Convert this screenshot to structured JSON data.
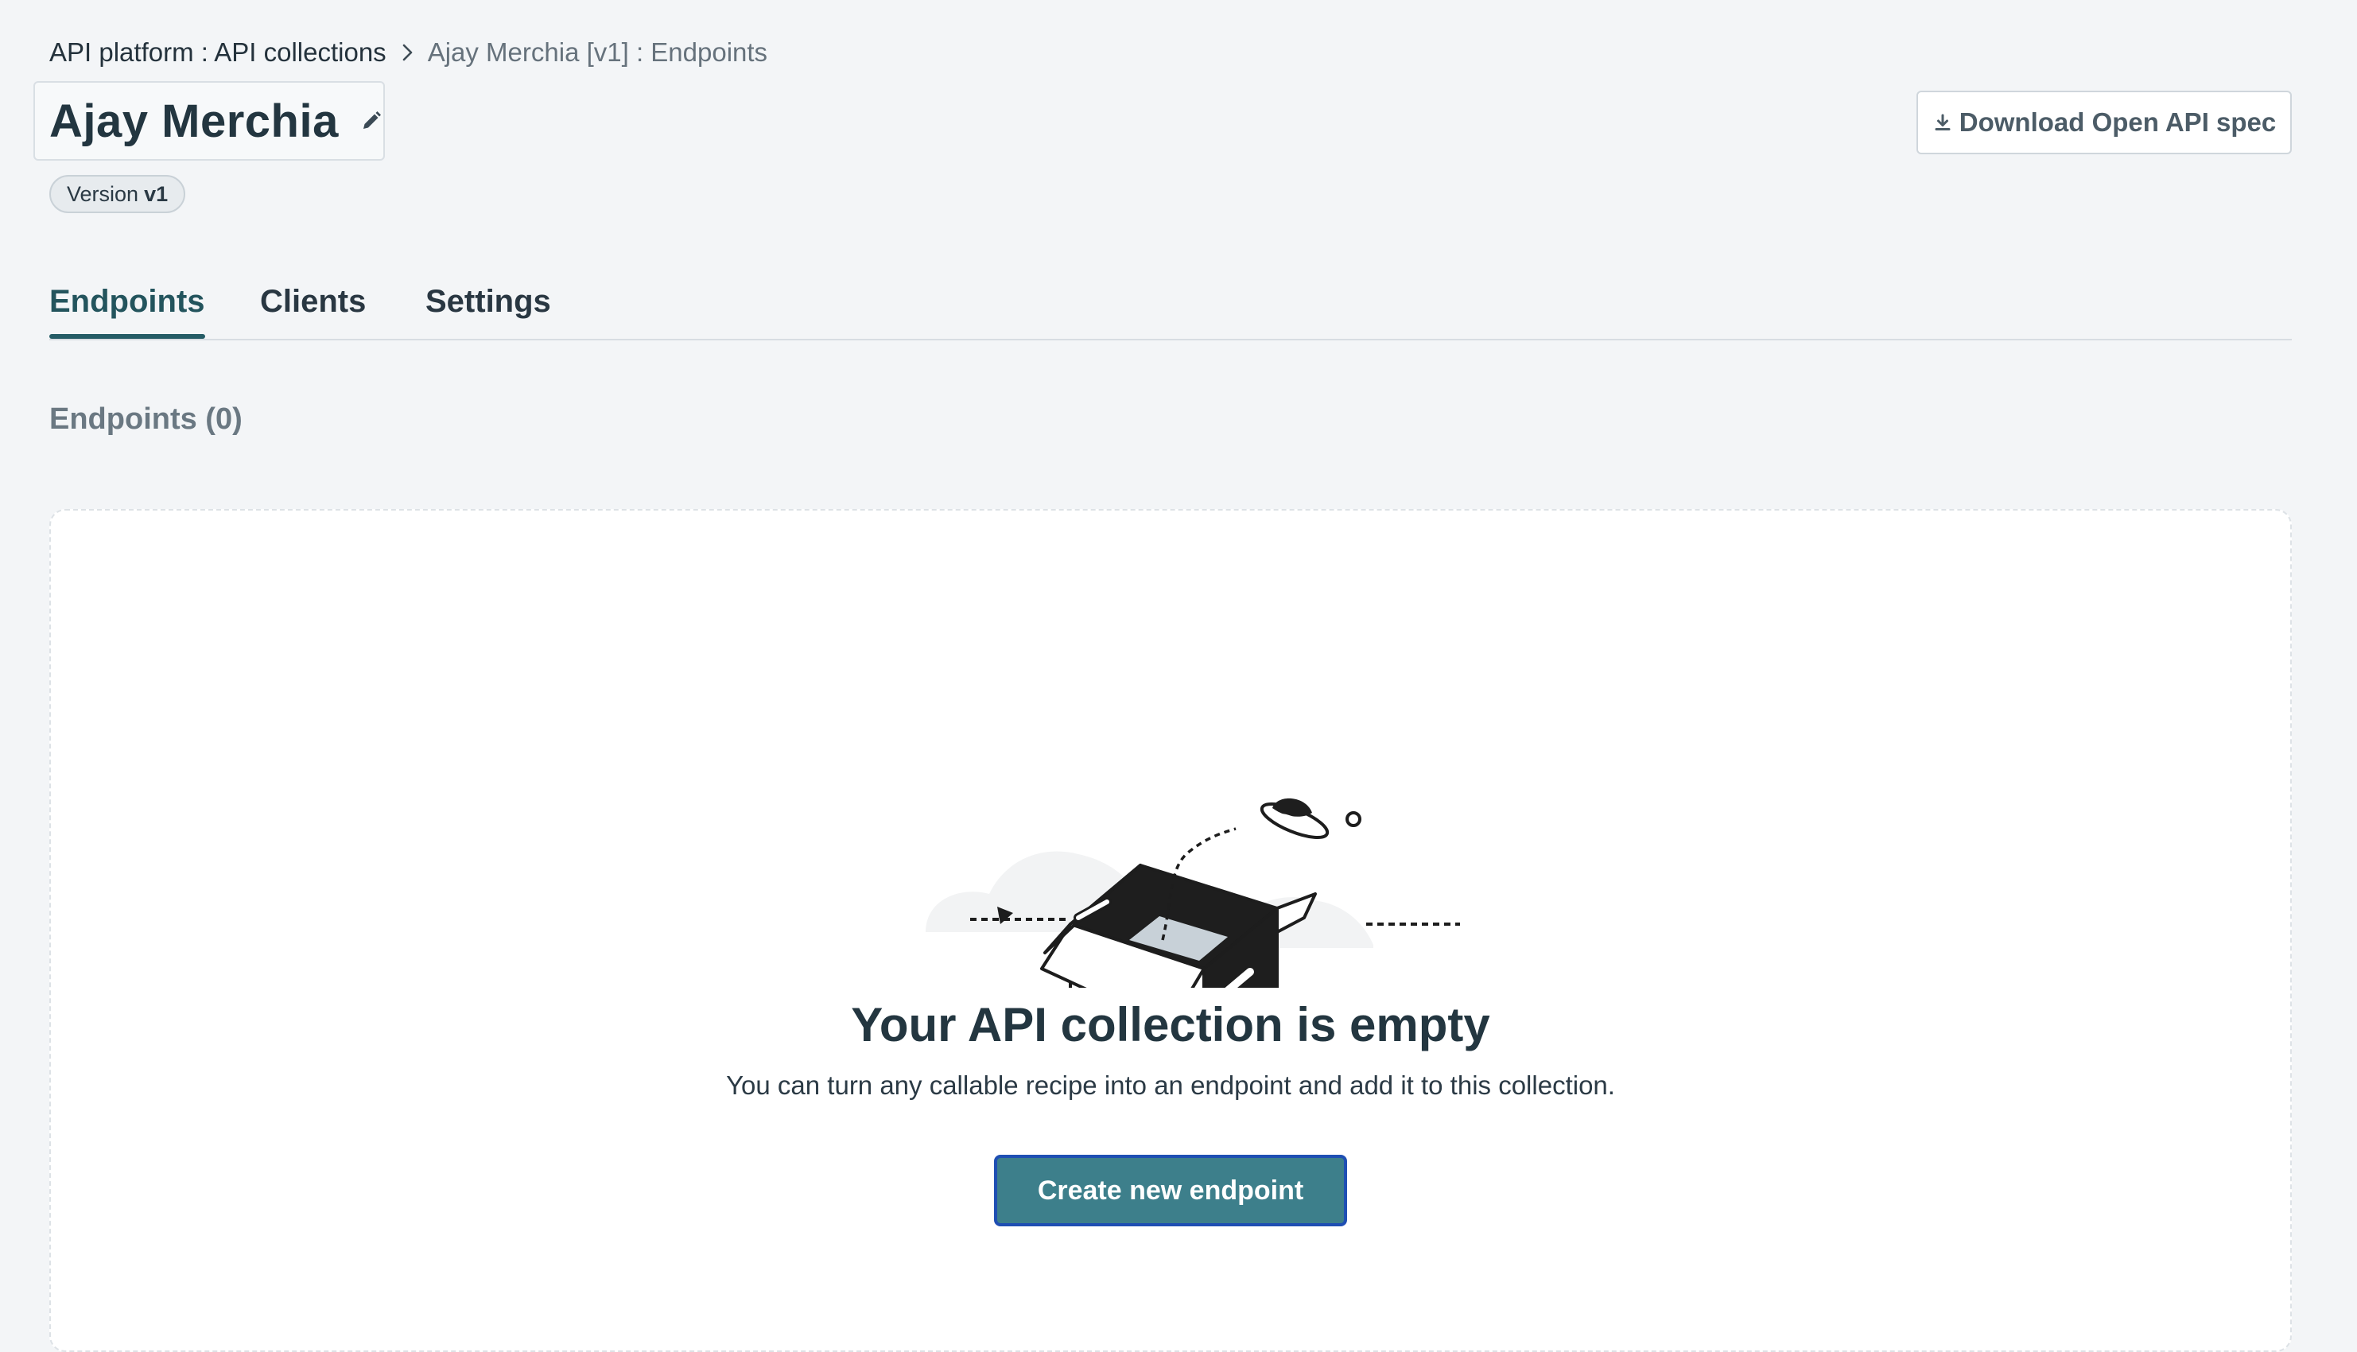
{
  "breadcrumb": {
    "parent": "API platform : API collections",
    "current": "Ajay Merchia [v1] : Endpoints"
  },
  "collection": {
    "title": "Ajay Merchia",
    "version_prefix": "Version",
    "version": "v1"
  },
  "header": {
    "download_label": "Download Open API spec"
  },
  "tabs": [
    {
      "label": "Endpoints",
      "active": true
    },
    {
      "label": "Clients",
      "active": false
    },
    {
      "label": "Settings",
      "active": false
    }
  ],
  "section": {
    "heading": "Endpoints (0)"
  },
  "empty_state": {
    "title": "Your API collection is empty",
    "description": "You can turn any callable recipe into an endpoint and add it to this collection.",
    "button_label": "Create new endpoint"
  },
  "icons": {
    "breadcrumb_separator": "chevron-right-icon",
    "edit": "pencil-icon",
    "download": "download-icon",
    "illustration": "empty-box-ufo-illustration"
  },
  "colors": {
    "background": "#f3f5f7",
    "primary_button": "#3d7f8b",
    "primary_button_border": "#1f4fb3",
    "active_tab": "#255c66",
    "text_dark": "#233640"
  }
}
